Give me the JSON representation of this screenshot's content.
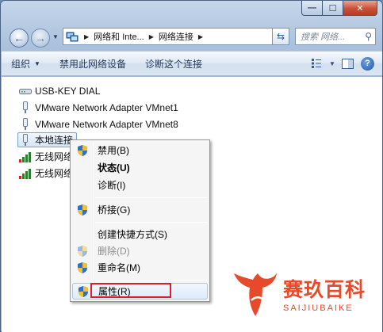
{
  "window": {
    "caption": {
      "minimize": "—",
      "maximize": "☐",
      "close": "✕"
    }
  },
  "address_bar": {
    "crumbs": [
      "网络和 Inte...",
      "网络连接"
    ],
    "search_placeholder": "搜索 网络..."
  },
  "toolbar": {
    "organize": "组织",
    "disable": "禁用此网络设备",
    "diagnose": "诊断这个连接",
    "help": "?"
  },
  "connections": [
    {
      "label": "USB-KEY DIAL",
      "icon": "modem-icon"
    },
    {
      "label": "VMware Network Adapter VMnet1",
      "icon": "network-adapter-icon"
    },
    {
      "label": "VMware Network Adapter VMnet8",
      "icon": "network-adapter-icon"
    },
    {
      "label": "本地连接",
      "icon": "network-adapter-icon",
      "selected": true
    },
    {
      "label": "无线网络",
      "icon": "wireless-signal-icon"
    },
    {
      "label": "无线网络",
      "icon": "wireless-signal-icon"
    }
  ],
  "context_menu": [
    {
      "label": "禁用(B)",
      "icon": "shield-icon"
    },
    {
      "label": "状态(U)",
      "bold": true
    },
    {
      "label": "诊断(I)"
    },
    {
      "label": "桥接(G)",
      "icon": "shield-icon"
    },
    {
      "label": "创建快捷方式(S)"
    },
    {
      "label": "删除(D)",
      "icon": "shield-icon",
      "disabled": true
    },
    {
      "label": "重命名(M)",
      "icon": "shield-icon"
    },
    {
      "label": "属性(R)",
      "icon": "shield-icon",
      "highlighted": true
    }
  ],
  "watermark": {
    "cn": "赛玖百科",
    "en": "SAIJIUBAIKE"
  },
  "colors": {
    "accent_red": "#d9202a",
    "watermark": "#e74a2a"
  }
}
